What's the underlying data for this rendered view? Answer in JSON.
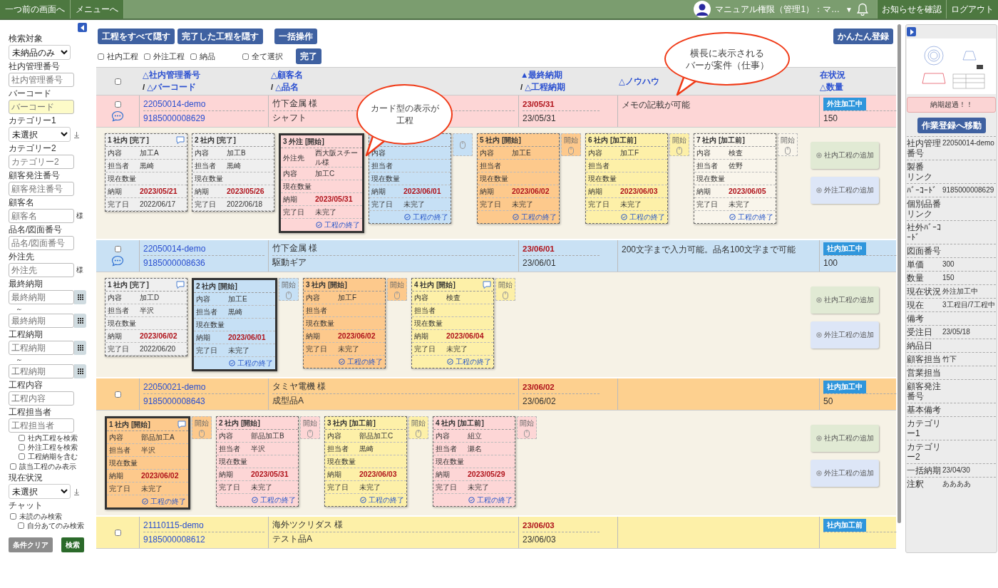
{
  "top_bar": {
    "nav": [
      "一つ前の画面へ",
      "メニューへ"
    ],
    "user": "マニュアル権限（管理1）：マ…",
    "caret": "▼",
    "actions": [
      "お知らせを確認",
      "ログアウト"
    ]
  },
  "sidebar": {
    "items": [
      {
        "kind": "select",
        "label": "検索対象",
        "value": "未納品のみ"
      },
      {
        "kind": "input",
        "label": "社内管理番号",
        "placeholder": "社内管理番号",
        "highlighted": false
      },
      {
        "kind": "input",
        "label": "バーコード",
        "placeholder": "バーコード",
        "highlighted": true
      },
      {
        "kind": "select_sort",
        "label": "カテゴリー1",
        "value": "未選択"
      },
      {
        "kind": "input",
        "label": "カテゴリー2",
        "placeholder": "カテゴリー2",
        "highlighted": false
      },
      {
        "kind": "input",
        "label": "顧客発注番号",
        "placeholder": "顧客発注番号",
        "highlighted": false
      },
      {
        "kind": "input",
        "label": "顧客名",
        "placeholder": "顧客名",
        "suffix": "様",
        "highlighted": false
      },
      {
        "kind": "input",
        "label": "品名/図面番号",
        "placeholder": "品名/図面番号",
        "highlighted": false
      },
      {
        "kind": "input",
        "label": "外注先",
        "placeholder": "外注先",
        "suffix": "様",
        "highlighted": false
      },
      {
        "kind": "date_range",
        "label": "最終納期",
        "from": {
          "placeholder": "最終納期"
        },
        "separator": "～",
        "to": {
          "placeholder": "最終納期"
        }
      },
      {
        "kind": "date_range",
        "label": "工程納期",
        "from": {
          "placeholder": "工程納期"
        },
        "separator": "～",
        "to": {
          "placeholder": "工程納期"
        }
      },
      {
        "kind": "input",
        "label": "工程内容",
        "placeholder": "工程内容",
        "highlighted": false
      },
      {
        "kind": "input",
        "label": "工程担当者",
        "placeholder": "工程担当者",
        "highlighted": false
      },
      {
        "kind": "checks_indented",
        "items": [
          {
            "label": "社内工程を検索",
            "checked": false
          },
          {
            "label": "外注工程を検索",
            "checked": false
          },
          {
            "label": "工程納期を含む",
            "checked": false
          }
        ]
      },
      {
        "kind": "checks",
        "items": [
          {
            "label": "該当工程のみ表示",
            "checked": false
          }
        ]
      },
      {
        "kind": "select_sort",
        "label": "現在状況",
        "value": "未選択"
      },
      {
        "kind": "checks",
        "label": "チャット",
        "items": [
          {
            "label": "未読のみ検索",
            "checked": false,
            "children": [
              {
                "label": "自分あてのみ検索",
                "checked": false
              }
            ]
          }
        ]
      }
    ],
    "buttons": [
      {
        "label": "条件クリア",
        "kind": "clear"
      },
      {
        "label": "検索",
        "kind": "search"
      }
    ]
  },
  "toolbar": {
    "buttons": [
      "工程をすべて隠す",
      "完了した工程を隠す",
      "一括操作"
    ],
    "register": "かんたん登録",
    "filters": [
      {
        "label": "社内工程",
        "checked": false
      },
      {
        "label": "外注工程",
        "checked": false
      },
      {
        "label": "納品",
        "checked": false
      }
    ],
    "select_all": {
      "label": "全て選択",
      "checked": false
    },
    "done": "完了"
  },
  "table": {
    "header_checkbox": {
      "checked": false
    },
    "columns": [
      {
        "top": "△社内管理番号",
        "slash": "/",
        "bottom": "△バーコード"
      },
      {
        "top": "△顧客名",
        "slash": "/",
        "bottom": "△品名"
      },
      {
        "top": "▲最終納期",
        "slash": "/",
        "bottom": "△工程納期"
      },
      {
        "top": "△ノウハウ"
      },
      {
        "top": "在状況",
        "bottom": "△数量"
      }
    ],
    "rows": [
      {
        "color": "#fdd6d6",
        "checked": false,
        "chat": true,
        "id": "22050014-demo",
        "barcode": "9185000008629",
        "customer": "竹下金属 様",
        "product": "シャフト",
        "due": "23/05/31",
        "process_due": "23/05/31",
        "knowhow": "メモの記載が可能",
        "status": "外注加工中",
        "quantity": "150",
        "add_buttons": [
          "社内工程の追加",
          "外注工程の追加"
        ],
        "cards": [
          {
            "title": "1 社内 [完了]",
            "color": "#efefef",
            "current": false,
            "chat": true,
            "fields": [
              {
                "label": "内容",
                "value": "加工A"
              },
              {
                "label": "担当者",
                "value": "黒崎"
              },
              {
                "label": "現在数量"
              },
              {
                "label": "納期",
                "value": "2023/05/21",
                "kind": "due"
              },
              {
                "label": "完了日",
                "value": "2022/06/17"
              }
            ]
          },
          {
            "title": "2 社内 [完了]",
            "color": "#efefef",
            "current": false,
            "chat": false,
            "fields": [
              {
                "label": "内容",
                "value": "加工B"
              },
              {
                "label": "担当者",
                "value": "黒崎"
              },
              {
                "label": "現在数量"
              },
              {
                "label": "納期",
                "value": "2023/05/26",
                "kind": "due"
              },
              {
                "label": "完了日",
                "value": "2022/06/18"
              }
            ]
          },
          {
            "title": "3 外注 [開始]",
            "color": "#fdd6d6",
            "current": true,
            "chat": false,
            "fields": [
              {
                "label": "外注先",
                "value": "西大阪スチール様"
              },
              {
                "label": "内容",
                "value": "加工C"
              },
              {
                "label": "現在数量"
              },
              {
                "label": "納期",
                "value": "2023/05/31",
                "kind": "due"
              },
              {
                "label": "完了日",
                "value": "未完了"
              }
            ],
            "finish": "工程の終了"
          },
          {
            "color": "#c6e0f5",
            "current": false,
            "chat": false,
            "start": true,
            "fields": [
              {
                "label": "内容"
              },
              {
                "label": "担当者"
              },
              {
                "label": "現在数量"
              },
              {
                "label": "納期",
                "value": "2023/06/01",
                "kind": "due"
              },
              {
                "label": "完了日",
                "value": "未完了"
              }
            ],
            "finish": "工程の終了"
          },
          {
            "title": "5 社内 [開始]",
            "color": "#fdc98c",
            "current": false,
            "chat": false,
            "start": true,
            "start_label": "開始",
            "fields": [
              {
                "label": "内容",
                "value": "加工E"
              },
              {
                "label": "担当者"
              },
              {
                "label": "現在数量"
              },
              {
                "label": "納期",
                "value": "2023/06/02",
                "kind": "due"
              },
              {
                "label": "完了日",
                "value": "未完了"
              }
            ],
            "finish": "工程の終了"
          },
          {
            "title": "6 社内 [加工前]",
            "color": "#fdf0a8",
            "current": false,
            "chat": false,
            "start": true,
            "start_label": "開始",
            "fields": [
              {
                "label": "内容",
                "value": "加工F"
              },
              {
                "label": "担当者"
              },
              {
                "label": "現在数量"
              },
              {
                "label": "納期",
                "value": "2023/06/03",
                "kind": "due"
              },
              {
                "label": "完了日",
                "value": "未完了"
              }
            ],
            "finish": "工程の終了"
          },
          {
            "title": "7 社内 [加工前]",
            "color": "#f9f5eb",
            "current": false,
            "chat": false,
            "start": true,
            "start_label": "開始",
            "fields": [
              {
                "label": "内容",
                "value": "検査"
              },
              {
                "label": "担当者",
                "value": "佐野"
              },
              {
                "label": "現在数量"
              },
              {
                "label": "納期",
                "value": "2023/06/05",
                "kind": "due"
              },
              {
                "label": "完了日",
                "value": "未完了"
              }
            ],
            "finish": "工程の終了"
          }
        ]
      },
      {
        "color": "#c9e1f4",
        "checked": false,
        "chat": true,
        "id": "22050014-demo",
        "barcode": "9185000008636",
        "customer": "竹下金属 様",
        "product": "駆動ギア",
        "due": "23/06/01",
        "process_due": "23/06/01",
        "knowhow": "200文字まで入力可能。品名100文字まで可能",
        "status": "社内加工中",
        "quantity": "100",
        "add_buttons": [
          "社内工程の追加",
          "外注工程の追加"
        ],
        "cards": [
          {
            "title": "1 社内 [完了]",
            "color": "#efefef",
            "current": false,
            "chat": true,
            "fields": [
              {
                "label": "内容",
                "value": "加工D"
              },
              {
                "label": "担当者",
                "value": "半沢"
              },
              {
                "label": "現在数量"
              },
              {
                "label": "納期",
                "value": "2023/06/02",
                "kind": "due"
              },
              {
                "label": "完了日",
                "value": "2022/06/20"
              }
            ]
          },
          {
            "title": "2 社内 [開始]",
            "color": "#c6e0f5",
            "current": true,
            "chat": false,
            "start": true,
            "start_label": "開始",
            "fields": [
              {
                "label": "内容",
                "value": "加工E"
              },
              {
                "label": "担当者",
                "value": "黒崎"
              },
              {
                "label": "現在数量"
              },
              {
                "label": "納期",
                "value": "2023/06/01",
                "kind": "due"
              },
              {
                "label": "完了日",
                "value": "未完了"
              }
            ],
            "finish": "工程の終了"
          },
          {
            "title": "3 社内 [開始]",
            "color": "#fdc98c",
            "current": false,
            "chat": false,
            "start": true,
            "start_label": "開始",
            "fields": [
              {
                "label": "内容",
                "value": "加工F"
              },
              {
                "label": "担当者"
              },
              {
                "label": "現在数量"
              },
              {
                "label": "納期",
                "value": "2023/06/02",
                "kind": "due"
              },
              {
                "label": "完了日",
                "value": "未完了"
              }
            ],
            "finish": "工程の終了"
          },
          {
            "title": "4 社内 [開始]",
            "color": "#fdf0a8",
            "current": false,
            "chat": true,
            "start": true,
            "start_label": "開始",
            "fields": [
              {
                "label": "内容",
                "value": "検査"
              },
              {
                "label": "担当者"
              },
              {
                "label": "現在数量"
              },
              {
                "label": "納期",
                "value": "2023/06/04",
                "kind": "due"
              },
              {
                "label": "完了日",
                "value": "未完了"
              }
            ],
            "finish": "工程の終了"
          }
        ]
      },
      {
        "color": "#fdd08f",
        "checked": false,
        "chat": false,
        "id": "22050021-demo",
        "barcode": "9185000008643",
        "customer": "タミヤ電機 様",
        "product": "成型品A",
        "due": "23/06/02",
        "process_due": "23/06/02",
        "status": "社内加工中",
        "quantity": "50",
        "add_buttons": [
          "社内工程の追加",
          "外注工程の追加"
        ],
        "cards": [
          {
            "title": "1 社内 [開始]",
            "color": "#fdc98c",
            "current": true,
            "chat": true,
            "start": true,
            "start_label": "開始",
            "fields": [
              {
                "label": "内容",
                "value": "部品加工A"
              },
              {
                "label": "担当者",
                "value": "半沢"
              },
              {
                "label": "現在数量"
              },
              {
                "label": "納期",
                "value": "2023/06/02",
                "kind": "due"
              },
              {
                "label": "完了日",
                "value": "未完了"
              }
            ],
            "finish": "工程の終了"
          },
          {
            "title": "2 社内 [開始]",
            "color": "#fdd6d6",
            "current": false,
            "chat": false,
            "start": true,
            "start_label": "開始",
            "fields": [
              {
                "label": "内容",
                "value": "部品加工B"
              },
              {
                "label": "担当者",
                "value": "半沢"
              },
              {
                "label": "現在数量"
              },
              {
                "label": "納期",
                "value": "2023/05/31",
                "kind": "due"
              },
              {
                "label": "完了日",
                "value": "未完了"
              }
            ],
            "finish": "工程の終了"
          },
          {
            "title": "3 社内 [加工前]",
            "color": "#fdf0a8",
            "current": false,
            "chat": false,
            "start": true,
            "start_label": "開始",
            "fields": [
              {
                "label": "内容",
                "value": "部品加工C"
              },
              {
                "label": "担当者",
                "value": "黒崎"
              },
              {
                "label": "現在数量"
              },
              {
                "label": "納期",
                "value": "2023/06/03",
                "kind": "due"
              },
              {
                "label": "完了日",
                "value": "未完了"
              }
            ],
            "finish": "工程の終了"
          },
          {
            "title": "4 社内 [加工前]",
            "color": "#fdd6d6",
            "current": false,
            "chat": false,
            "start": true,
            "start_label": "開始",
            "fields": [
              {
                "label": "内容",
                "value": "組立"
              },
              {
                "label": "担当者",
                "value": "瀬名"
              },
              {
                "label": "現在数量"
              },
              {
                "label": "納期",
                "value": "2023/05/29",
                "kind": "due"
              },
              {
                "label": "完了日",
                "value": "未完了"
              }
            ],
            "finish": "工程の終了"
          }
        ]
      },
      {
        "color": "#fdf0a8",
        "checked": false,
        "chat": false,
        "id": "21110115-demo",
        "barcode": "9185000008612",
        "customer": "海外ツクリダス 様",
        "product": "テスト品A",
        "due": "23/06/03",
        "process_due": "23/06/03",
        "status": "社内加工前"
      }
    ]
  },
  "callouts": [
    {
      "lines": [
        "カード型の表示が",
        "工程"
      ],
      "kind": "cards"
    },
    {
      "lines": [
        "横長に表示される",
        "バーが案件（仕事）"
      ],
      "kind": "bars"
    }
  ],
  "detail_panel": {
    "alert": "納期超過！！",
    "button": "作業登録へ移動",
    "fields": [
      {
        "label": "社内管理番号",
        "value": "22050014-demo"
      },
      {
        "label": "製番",
        "link": "リンク"
      },
      {
        "label": "ﾊﾞｰｺｰﾄﾞ",
        "value": "9185000008629"
      },
      {
        "label": "個別品番",
        "link": "リンク"
      },
      {
        "label": "社外ﾊﾞｰｺｰﾄﾞ"
      },
      {
        "label": "図面番号"
      },
      {
        "label": "単価",
        "value": "300"
      },
      {
        "label": "数量",
        "value": "150"
      },
      {
        "label": "現在状況",
        "value": "外注加工中"
      },
      {
        "label": "現在",
        "value": "3工程目/7工程中"
      },
      {
        "label": "備考"
      },
      {
        "label": "受注日",
        "value": "23/05/18"
      },
      {
        "label": "納品日"
      },
      {
        "label": "顧客担当",
        "value": "竹下"
      },
      {
        "label": "営業担当"
      },
      {
        "label": "顧客発注番号"
      },
      {
        "label": "基本備考"
      },
      {
        "label": "カテゴリー1"
      },
      {
        "label": "カテゴリー2"
      },
      {
        "label": "一括納期",
        "value": "23/04/30"
      },
      {
        "label": "注釈",
        "value": "ああああ"
      }
    ]
  }
}
